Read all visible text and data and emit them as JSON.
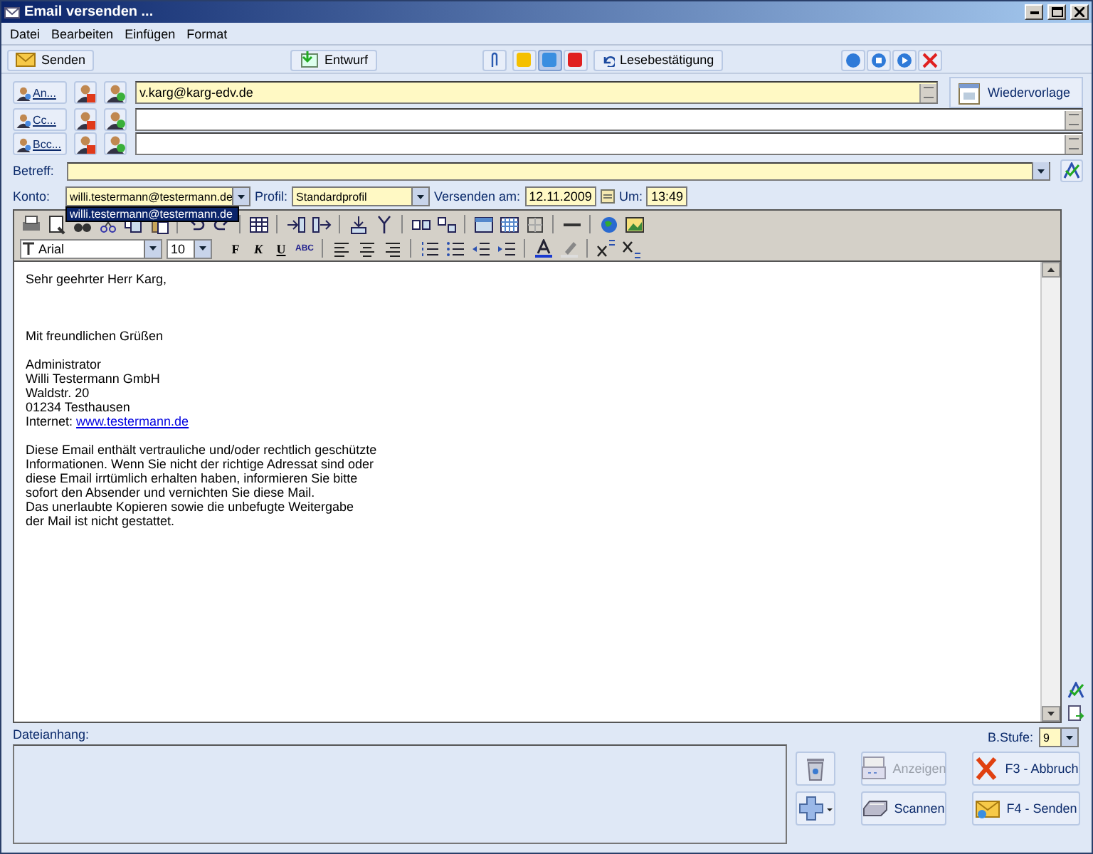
{
  "window": {
    "title": "Email versenden ..."
  },
  "menu": [
    "Datei",
    "Bearbeiten",
    "Einfügen",
    "Format"
  ],
  "toolbar": {
    "send": "Senden",
    "draft": "Entwurf",
    "receipt": "Lesebestätigung",
    "priorities": [
      {
        "color": "#f5c000",
        "selected": false
      },
      {
        "color": "#3a8ee0",
        "selected": true
      },
      {
        "color": "#e02020",
        "selected": false
      }
    ]
  },
  "recipients": [
    {
      "label": "An...",
      "value": "v.karg@karg-edv.de",
      "highlighted": true
    },
    {
      "label": "Cc...",
      "highlighted": false
    },
    {
      "label": "Bcc...",
      "highlighted": false
    }
  ],
  "follow_up": "Wiedervorlage",
  "subject": {
    "label": "Betreff:"
  },
  "account": {
    "label": "Konto:",
    "value": "willi.testermann@testermann.de",
    "options": [
      {
        "label": "willi.testermann@testermann.de",
        "selected": true
      }
    ]
  },
  "profile": {
    "label": "Profil:",
    "value": "Standardprofil"
  },
  "send_date": {
    "label": "Versenden am:",
    "value": "12.11.2009"
  },
  "send_time": {
    "label": "Um:",
    "value": "13:49"
  },
  "editor": {
    "font": "Arial",
    "size": "10",
    "format_buttons": [
      "F",
      "K",
      "U",
      "ABC"
    ],
    "paragraphs": [
      {
        "kind": "greeting",
        "lines": [
          {
            "text": "Sehr geehrter Herr Karg,"
          }
        ]
      },
      {
        "kind": "normal",
        "lines": [
          {
            "text": "Mit freundlichen Grüßen"
          }
        ]
      },
      {
        "kind": "normal",
        "lines": [
          {
            "text": "Administrator"
          },
          {
            "text": "Willi Testermann GmbH"
          },
          {
            "text": "Waldstr. 20"
          },
          {
            "text": "01234 Testhausen"
          },
          {
            "text": "Internet: ",
            "link": "www.testermann.de"
          }
        ]
      },
      {
        "kind": "normal",
        "lines": [
          {
            "text": "Diese Email enthält vertrauliche und/oder rechtlich geschützte"
          },
          {
            "text": "Informationen. Wenn Sie nicht der richtige Adressat sind oder"
          },
          {
            "text": "diese Email irrtümlich erhalten haben, informieren Sie bitte"
          },
          {
            "text": "sofort den Absender und vernichten Sie diese Mail."
          },
          {
            "text": "Das unerlaubte Kopieren sowie die unbefugte Weitergabe"
          },
          {
            "text": "der Mail ist nicht gestattet."
          }
        ]
      }
    ]
  },
  "attachments": {
    "label": "Dateianhang:"
  },
  "security_level": {
    "label": "B.Stufe:",
    "value": "9"
  },
  "actions": [
    {
      "kind": "view",
      "label": "Anzeigen",
      "disabled": true
    },
    {
      "kind": "cancel",
      "label": "F3 - Abbruch",
      "disabled": false
    },
    {
      "kind": "scan",
      "label": "Scannen",
      "disabled": false
    },
    {
      "kind": "send",
      "label": "F4 - Senden",
      "disabled": false
    }
  ]
}
